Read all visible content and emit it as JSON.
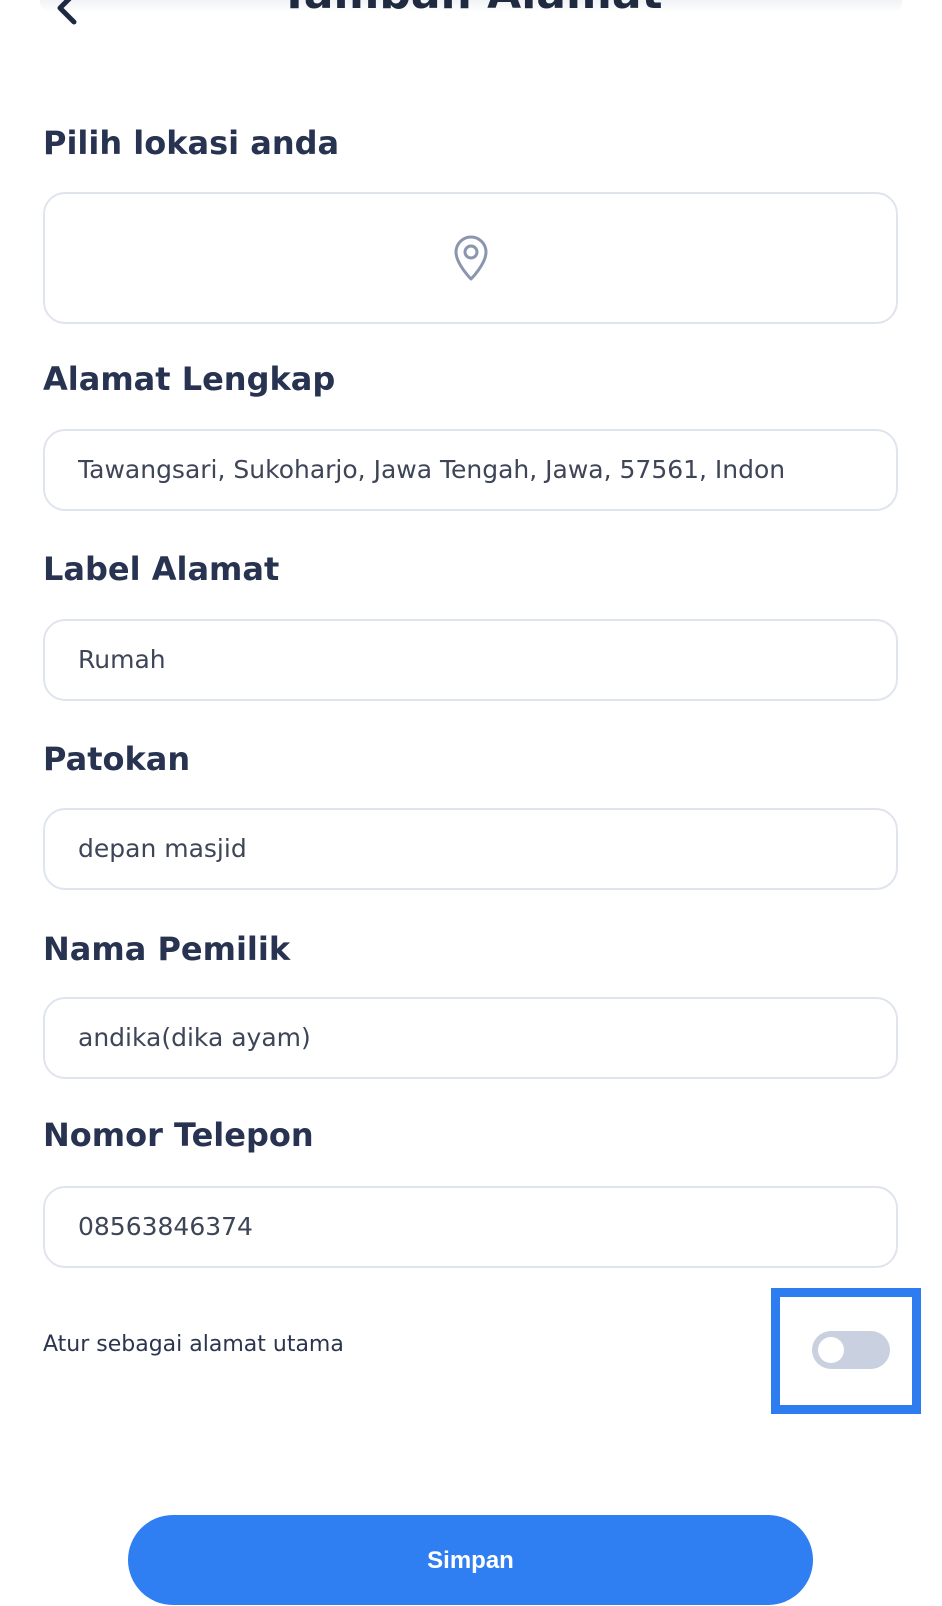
{
  "header": {
    "title": "Tambah Alamat",
    "back_icon": "chevron-left-icon"
  },
  "form": {
    "location": {
      "label": "Pilih lokasi anda",
      "icon": "location-pin-icon"
    },
    "full_address": {
      "label": "Alamat Lengkap",
      "value": "Tawangsari, Sukoharjo, Jawa Tengah, Jawa, 57561, Indon"
    },
    "address_label": {
      "label": "Label Alamat",
      "value": "Rumah"
    },
    "landmark": {
      "label": "Patokan",
      "value": "depan masjid"
    },
    "owner_name": {
      "label": "Nama Pemilik",
      "value": "andika(dika ayam)"
    },
    "phone": {
      "label": "Nomor Telepon",
      "value": "08563846374"
    },
    "primary_toggle": {
      "label": "Atur sebagai alamat utama",
      "checked": false
    }
  },
  "actions": {
    "save_label": "Simpan"
  },
  "colors": {
    "accent": "#2f7ff2",
    "highlight": "#2d7df0",
    "toggle_off": "#c9d0e0",
    "border": "#dfe4ee",
    "label_text": "#273350"
  }
}
